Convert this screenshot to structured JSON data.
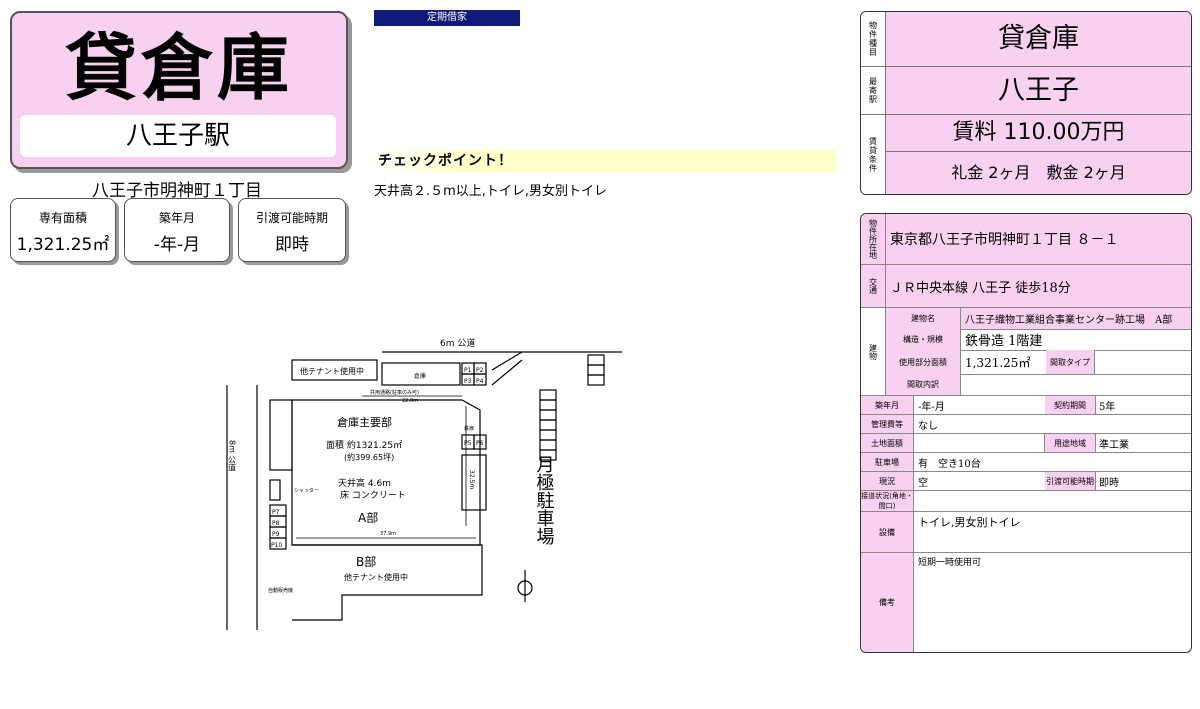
{
  "header": {
    "property_type": "貸倉庫",
    "station": "八王子駅",
    "address": "八王子市明神町１丁目",
    "badge": "定期借家"
  },
  "stats": [
    {
      "label": "専有面積",
      "value": "1,321.25㎡"
    },
    {
      "label": "築年月",
      "value": "-年-月"
    },
    {
      "label": "引渡可能時期",
      "value": "即時"
    }
  ],
  "checkpoint": {
    "title": "チェックポイント！",
    "body": "天井高２.５m以上,トイレ,男女別トイレ"
  },
  "summary": {
    "type_label": "物件種目",
    "type_value": "貸倉庫",
    "station_label": "最寄駅",
    "station_value": "八王子",
    "terms_label": "賃貸条件",
    "rent": "賃料 110.00万円",
    "deposit": "礼金 2ヶ月　敷金 2ヶ月"
  },
  "details": {
    "location_label": "物件所在地",
    "location_value": "東京都八王子市明神町１丁目 ８－１",
    "transit_label": "交通",
    "transit_value": "ＪＲ中央本線 八王子 徒歩18分",
    "building_label": "建物",
    "building_name_label": "建物名",
    "building_name": "八王子織物工業組合事業センター跡工場　A部",
    "structure_label": "構造・規模",
    "structure": "鉄骨造 1階建",
    "area_label": "使用部分面積",
    "area": "1,321.25㎡",
    "layout_type_label": "間取タイプ",
    "layout_detail_label": "間取内訳",
    "built_label": "築年月",
    "built": "-年-月",
    "contract_label": "契約期間",
    "contract": "5年",
    "mgmt_label": "管理費等",
    "mgmt": "なし",
    "land_label": "土地面積",
    "zoning_label": "用途地域",
    "zoning": "準工業",
    "parking_label": "駐車場",
    "parking": "有　空き10台",
    "status_label": "現況",
    "status": "空",
    "handover_label": "引渡可能時期",
    "handover": "即時",
    "road_label": "接道状況(角地・間口)",
    "facilities_label": "設備",
    "facilities": "トイレ,男女別トイレ",
    "remarks_label": "備考",
    "remarks": "短期一時使用可"
  },
  "floorplan": {
    "road_top": "6m 公道",
    "road_left": "8m 公道",
    "other_tenant_top": "他テナント使用中",
    "warehouse_small": "倉庫",
    "main_title": "倉庫主要部",
    "main_area": "面積 約1321.25㎡",
    "main_tsubo": "(約399.65坪)",
    "ceiling": "天井高 4.6m",
    "floor": "床 コンクリート",
    "part_a": "A部",
    "part_b": "B部",
    "other_tenant_b": "他テナント使用中",
    "parking_label": "月極駐車場",
    "shared_path": "共用通路(駐車のみ可)",
    "dim_22": "22.0m",
    "dim_37": "37.9m",
    "dim_32": "32.5m",
    "shutter": "シャッター",
    "door": "鉄扉",
    "p1": "P1",
    "p2": "P2",
    "p3": "P3",
    "p4": "P4",
    "p5": "P5",
    "p6": "P6",
    "p7": "P7",
    "p8": "P8",
    "p9": "P9",
    "p10": "P10",
    "bike": "自動販売機"
  }
}
